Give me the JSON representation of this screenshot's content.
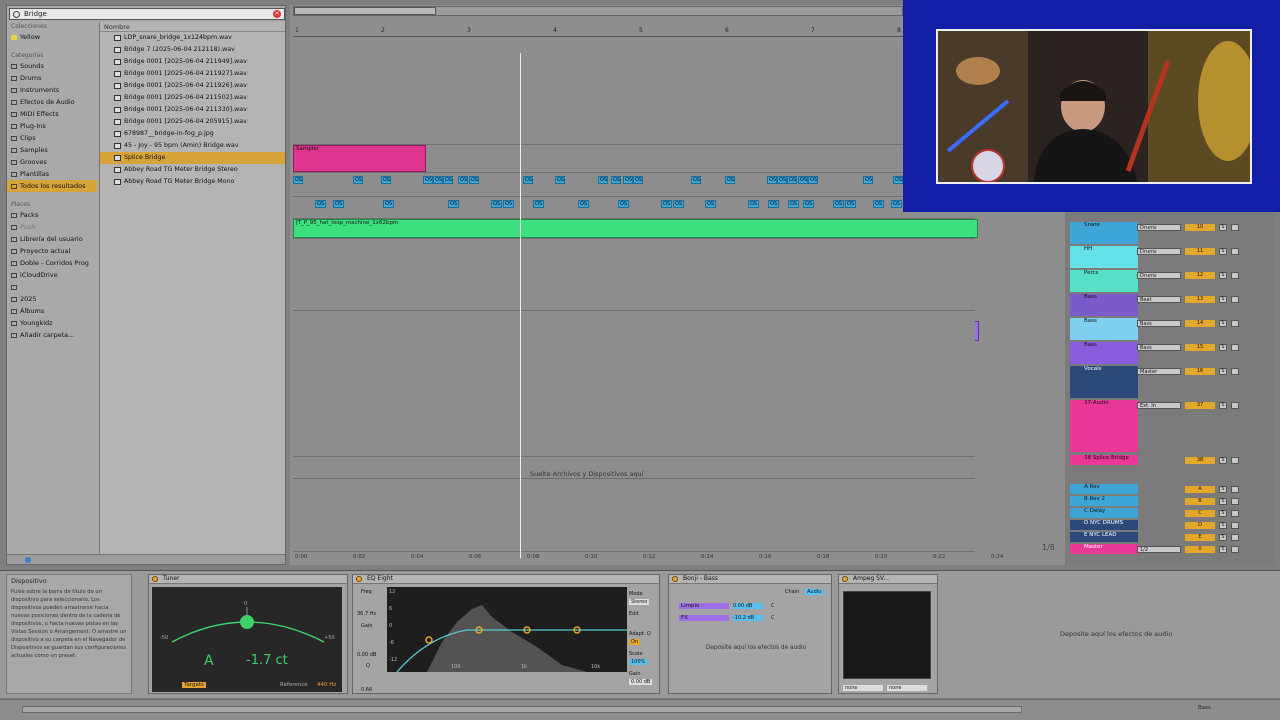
{
  "browser": {
    "search_value": "Bridge",
    "places_header_collections": "Colecciones",
    "collections": [
      {
        "label": "Yellow",
        "color": "#e8d33a"
      }
    ],
    "places_header_categories": "Categorías",
    "categories": [
      "Sounds",
      "Drums",
      "Instruments",
      "Efectos de Audio",
      "MIDI Effects",
      "Plug-Ins",
      "Clips",
      "Samples",
      "Grooves",
      "Plantillas",
      "Todos los resultados"
    ],
    "places_header_places": "Places",
    "places": [
      "Packs",
      "Push",
      "Librería del usuario",
      "Proyecto actual",
      "Doble - Corridos Prog",
      "iCloudDrive",
      "",
      "2025",
      "Álbums",
      "Youngkidz",
      "Añadir carpeta..."
    ],
    "files_header": "Nombre",
    "files": [
      "LDP_snare_bridge_1x124bpm.wav",
      "Bridge 7 (2025-06-04 212118).wav",
      "Bridge 0001 [2025-06-04 211949].wav",
      "Bridge 0001 [2025-06-04 211927].wav",
      "Bridge 0001 [2025-06-04 211926].wav",
      "Bridge 0001 [2025-06-04 211502].wav",
      "Bridge 0001 [2025-06-04 211330].wav",
      "Bridge 0001 [2025-06-04 205915].wav",
      "678987__bridge-in-fog_p.jpg",
      "45 - Joy - 95 bpm (Amin) Bridge.wav",
      "Splice Bridge",
      "Abbey Road TG Meter Bridge Stereo",
      "Abbey Road TG Meter Bridge Mono"
    ]
  },
  "arrangement": {
    "bar_numbers": [
      "1",
      "2",
      "3",
      "4",
      "5",
      "6",
      "7",
      "8"
    ],
    "clip_pink_label": "Sampler",
    "clip_green_label": "JT_P_95_hat_loop_machine_1x62bpm",
    "clip_bass_labels": [
      "Ba",
      "Ba",
      "Bass 12",
      "Bass 12",
      "Ba",
      "Ba",
      "Bass 12",
      "Bass 12",
      "Bass 12"
    ],
    "mini_clip_label": "OS",
    "drop_text": "Suelte Archivos y Dispositivos aquí",
    "time_ticks": [
      "0:00",
      "0:02",
      "0:04",
      "0:06",
      "0:08",
      "0:10",
      "0:12",
      "0:14",
      "0:16",
      "0:18",
      "0:20",
      "0:22",
      "0:24"
    ],
    "loop_counter": "1/8"
  },
  "mixer": {
    "tracks": [
      {
        "name": "Snare",
        "color": "#3ea6d6",
        "input": "Drums",
        "num": "10"
      },
      {
        "name": "HH",
        "color": "#64e0e8",
        "input": "Drums",
        "num": "11"
      },
      {
        "name": "Percs",
        "color": "#56e0c8",
        "input": "Drums",
        "num": "12"
      },
      {
        "name": "Bass",
        "color": "#7b5bc9",
        "input": "Beat",
        "num": "13"
      },
      {
        "name": "Bass",
        "color": "#7fd0ef",
        "input": "Bass",
        "num": "14"
      },
      {
        "name": "Bass",
        "color": "#8a5ce0",
        "input": "Bass",
        "num": "15"
      },
      {
        "name": "Vocals",
        "color": "#2a4a7a",
        "input": "Master",
        "num": "16"
      },
      {
        "name": "37-Audio",
        "color": "#e83898",
        "input": "Ext. In",
        "num": "37"
      },
      {
        "name": "38 Splice Bridge",
        "color": "#e83898",
        "input": "",
        "num": "38"
      },
      {
        "name": "A Rev",
        "color": "#3ea6d6",
        "input": "",
        "num": "A"
      },
      {
        "name": "B Rev 2",
        "color": "#3ea6d6",
        "input": "",
        "num": "B"
      },
      {
        "name": "C Delay",
        "color": "#3ea6d6",
        "input": "",
        "num": "C"
      },
      {
        "name": "D NYC DRUMS",
        "color": "#2a4a7a",
        "input": "",
        "num": "D"
      },
      {
        "name": "E NYC LEAD",
        "color": "#2a4a7a",
        "input": "",
        "num": "E"
      },
      {
        "name": "Master",
        "color": "#e83898",
        "input": "1/2",
        "num": "0"
      }
    ]
  },
  "devices": {
    "info_title": "Dispositivo",
    "info_text": "Pulse sobre la barra de título de un dispositivo para seleccionarlo. Los dispositivos pueden arrastrarse hacia nuevas posiciones dentro de la cadena de dispositivos, o hacia nuevas pistas en las Vistas Session o Arrangement. O arrastre un dispositivo a su carpeta en el Navegador de Dispositivos se guardan sus configuraciones actuales como un preset.",
    "tuner": {
      "title": "Tuner",
      "note": "A",
      "cents": "-1.7 ct",
      "mode": "Targets",
      "reference_label": "Reference",
      "reference_value": "440 Hz",
      "scale_left": "-50",
      "scale_right": "+50",
      "scale_top": "0"
    },
    "eq": {
      "title": "EQ Eight",
      "freq_label": "Freq",
      "freq_value": "36.7 Hz",
      "gain_label": "Gain",
      "gain_value": "0.00 dB",
      "q_label": "Q",
      "q_value": "0.66",
      "mode_label": "Mode",
      "mode_value": "Stereo",
      "edit_label": "Edit",
      "adapt_label": "Adapt. Q",
      "adapt_value": "On",
      "scale_label": "Scale",
      "scale_value": "100%",
      "out_gain_label": "Gain",
      "out_gain_value": "0.00 dB",
      "db_ticks": [
        "12",
        "6",
        "0",
        "-6",
        "-12"
      ],
      "freq_ticks": [
        "100",
        "1k",
        "10k"
      ]
    },
    "bonji": {
      "title": "Bonji - Bass",
      "chain_label": "Chain",
      "chain_value": "Audio",
      "chains": [
        {
          "name": "Limpio",
          "gain": "0.00 dB",
          "pan": "C"
        },
        {
          "name": "FX",
          "gain": "-10.2 dB",
          "pan": "C"
        }
      ],
      "drop_text": "Deposite aquí los efectos de audio"
    },
    "ampeg": {
      "title": "Ampeg SV...",
      "in_value": "none",
      "out_value": "none"
    },
    "audio_drop": "Deposite aquí los efectos de audio"
  },
  "status": {
    "track_label": "Bass"
  }
}
